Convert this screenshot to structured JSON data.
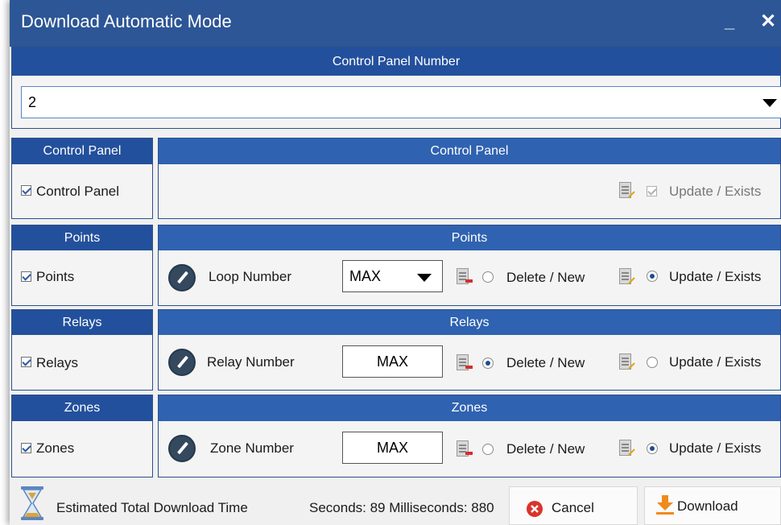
{
  "window": {
    "title": "Download Automatic Mode",
    "minimize": "_",
    "close": "✕"
  },
  "panel_number": {
    "header": "Control Panel Number",
    "selected": "2"
  },
  "sections": {
    "control_panel": {
      "left_header": "Control Panel",
      "checkbox_label": "Control Panel",
      "checked": true,
      "right_header": "Control Panel",
      "update_label": "Update / Exists",
      "update_enabled": false
    },
    "points": {
      "left_header": "Points",
      "checkbox_label": "Points",
      "checked": true,
      "right_header": "Points",
      "number_label": "Loop Number",
      "number_value": "MAX",
      "delete_label": "Delete / New",
      "update_label": "Update / Exists",
      "selected": "update"
    },
    "relays": {
      "left_header": "Relays",
      "checkbox_label": "Relays",
      "checked": true,
      "right_header": "Relays",
      "number_label": "Relay Number",
      "number_value": "MAX",
      "delete_label": "Delete / New",
      "update_label": "Update / Exists",
      "selected": "delete"
    },
    "zones": {
      "left_header": "Zones",
      "checkbox_label": "Zones",
      "checked": true,
      "right_header": "Zones",
      "number_label": "Zone Number",
      "number_value": "MAX",
      "delete_label": "Delete / New",
      "update_label": "Update / Exists",
      "selected": "update"
    }
  },
  "footer": {
    "estimate_label": "Estimated Total Download Time",
    "time_value": "Seconds: 89 Milliseconds: 880",
    "cancel_label": "Cancel",
    "download_label": "Download"
  },
  "colors": {
    "titlebar": "#2d5696",
    "header": "#23509c",
    "accent": "#1f4b8f",
    "cancel_icon": "#d9342b",
    "download_icon": "#f08a1c"
  }
}
